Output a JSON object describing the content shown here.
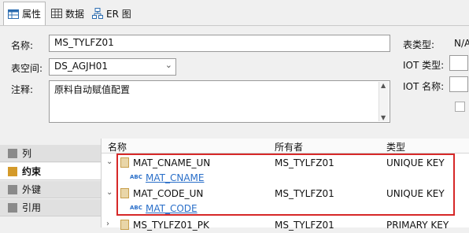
{
  "tabs": [
    {
      "label": "属性",
      "icon": "table-icon",
      "active": true
    },
    {
      "label": "数据",
      "icon": "grid-icon",
      "active": false
    },
    {
      "label": "ER 图",
      "icon": "er-diagram-icon",
      "active": false
    }
  ],
  "form": {
    "name_label": "名称:",
    "name_value": "MS_TYLFZ01",
    "tablespace_label": "表空间:",
    "tablespace_value": "DS_AGJH01",
    "comment_label": "注释:",
    "comment_value": "原料自动赋值配置",
    "table_type_label": "表类型:",
    "table_type_value": "N/A",
    "iot_type_label": "IOT 类型:",
    "iot_name_label": "IOT 名称:"
  },
  "nav": {
    "items": [
      {
        "label": "列",
        "active": false
      },
      {
        "label": "约束",
        "active": true
      },
      {
        "label": "外键",
        "active": false
      },
      {
        "label": "引用",
        "active": false
      }
    ]
  },
  "grid": {
    "columns": [
      "名称",
      "所有者",
      "类型"
    ],
    "rows": [
      {
        "name": "MAT_CNAME_UN",
        "owner": "MS_TYLFZ01",
        "type": "UNIQUE KEY",
        "child": "MAT_CNAME"
      },
      {
        "name": "MAT_CODE_UN",
        "owner": "MS_TYLFZ01",
        "type": "UNIQUE KEY",
        "child": "MAT_CODE"
      },
      {
        "name": "MS_TYLFZ01_PK",
        "owner": "MS_TYLFZ01",
        "type": "PRIMARY KEY"
      }
    ],
    "abc_badge": "ABC"
  },
  "colors": {
    "highlight_border": "#d62828",
    "link": "#2a6fc9"
  }
}
